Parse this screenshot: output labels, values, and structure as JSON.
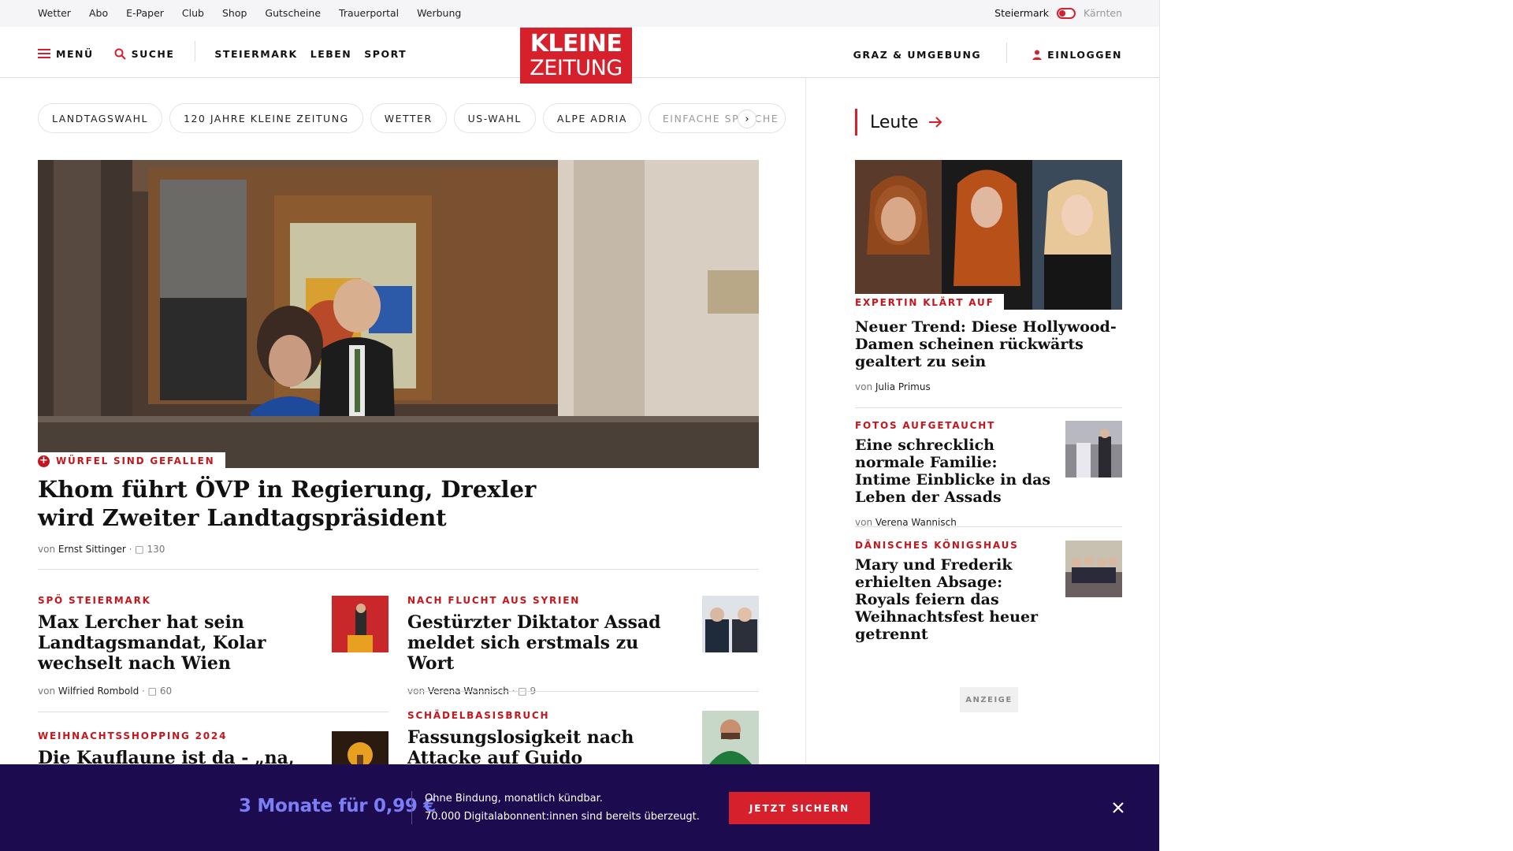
{
  "utility_bar": {
    "links": [
      "Wetter",
      "Abo",
      "E-Paper",
      "Club",
      "Shop",
      "Gutscheine",
      "Trauerportal",
      "Werbung"
    ],
    "region_active": "Steiermark",
    "region_inactive": "Kärnten"
  },
  "header": {
    "menu_label": "MENÜ",
    "search_label": "SUCHE",
    "sections": [
      "STEIERMARK",
      "LEBEN",
      "SPORT"
    ],
    "logo_line1": "KLEINE",
    "logo_line2": "ZEITUNG",
    "local_label": "GRAZ & UMGEBUNG",
    "login_label": "EINLOGGEN"
  },
  "tags": [
    "LANDTAGSWAHL",
    "120 JAHRE KLEINE ZEITUNG",
    "WETTER",
    "US-WAHL",
    "ALPE ADRIA",
    "EINFACHE SPRACHE"
  ],
  "hero": {
    "kicker": "WÜRFEL SIND GEFALLEN",
    "title": "Khom führt ÖVP in Regierung, Drexler wird Zweiter Landtagspräsident",
    "by_prefix": "von",
    "author": "Ernst Sittinger",
    "comments": "130"
  },
  "teasers": [
    {
      "kicker": "SPÖ STEIERMARK",
      "title": "Max Lercher hat sein Landtagsmandat, Kolar wechselt nach Wien",
      "by_prefix": "von",
      "author": "Wilfried Rombold",
      "comments": "60"
    },
    {
      "kicker": "NACH FLUCHT AUS SYRIEN",
      "title": "Gestürzter Diktator Assad meldet sich erstmals zu Wort",
      "by_prefix": "von",
      "author": "Verena Wannisch",
      "comments": "9"
    },
    {
      "kicker": "WEIHNACHTSSHOPPING 2024",
      "title": "Die Kauflaune ist da - „na,"
    },
    {
      "kicker": "SCHÄDELBASISBRUCH",
      "title": "Fassungslosigkeit nach Attacke auf Guido Burgstaller:"
    }
  ],
  "sidebar": {
    "section_title": "Leute",
    "lead": {
      "kicker": "EXPERTIN KLÄRT AUF",
      "title": "Neuer Trend: Diese Hollywood-Damen scheinen rückwärts gealtert zu sein",
      "by_prefix": "von",
      "author": "Julia Primus"
    },
    "items": [
      {
        "kicker": "FOTOS AUFGETAUCHT",
        "title": "Eine schrecklich normale Familie: Intime Einblicke in das Leben der Assads",
        "by_prefix": "von",
        "author": "Verena Wannisch"
      },
      {
        "kicker": "DÄNISCHES KÖNIGSHAUS",
        "title": "Mary und Frederik erhielten Absage: Royals feiern das Weihnachtsfest heuer getrennt"
      }
    ],
    "ad_label": "ANZEIGE"
  },
  "promo": {
    "price": "3 Monate für 0,99 €",
    "line1": "Ohne Bindung, monatlich kündbar.",
    "line2": "70.000 Digitalabonnent:innen sind bereits überzeugt.",
    "cta": "JETZT SICHERN"
  },
  "colors": {
    "brand_red": "#d6202b",
    "kicker_red": "#c4161c",
    "promo_bg": "#1c0b4f",
    "promo_price": "#7c7ef7"
  }
}
